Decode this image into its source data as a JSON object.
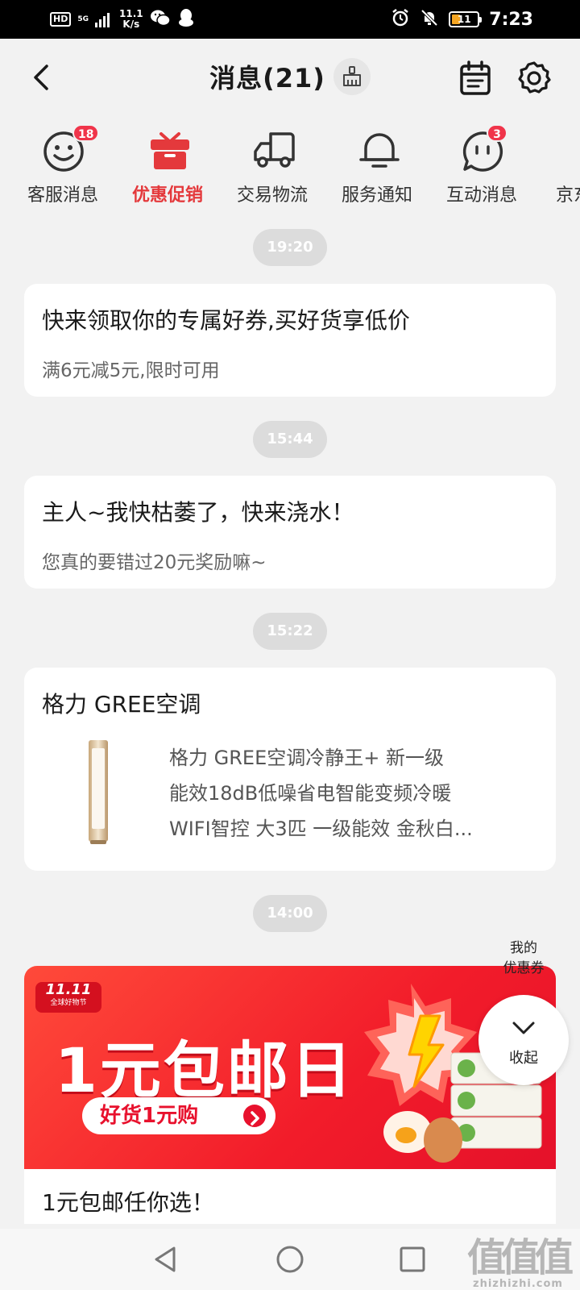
{
  "status_bar": {
    "hd": "HD",
    "network": "5G",
    "speed_value": "11.1",
    "speed_unit": "K/s",
    "battery": "11",
    "time": "7:23"
  },
  "header": {
    "title": "消息(21)"
  },
  "categories": [
    {
      "label": "客服消息",
      "badge": "18",
      "icon": "smiley-icon"
    },
    {
      "label": "优惠促销",
      "badge": "",
      "icon": "gift-icon",
      "active": true
    },
    {
      "label": "交易物流",
      "badge": "",
      "icon": "truck-icon"
    },
    {
      "label": "服务通知",
      "badge": "",
      "icon": "bell-icon"
    },
    {
      "label": "互动消息",
      "badge": "3",
      "icon": "chat-face-icon"
    },
    {
      "label": "京东",
      "badge": "",
      "icon": "more-icon"
    }
  ],
  "messages": [
    {
      "time": "19:20",
      "title": "快来领取你的专属好券,买好货享低价",
      "subtitle": "满6元减5元,限时可用"
    },
    {
      "time": "15:44",
      "title": "主人~我快枯萎了，快来浇水！",
      "subtitle": "您真的要错过20元奖励嘛~"
    },
    {
      "time": "15:22",
      "title": "格力   GREE空调",
      "product_lines": [
        "格力   GREE空调冷静王+ 新一级",
        "能效18dB低噪省电智能变频冷暖",
        "WIFI智控 大3匹 一级能效 金秋白..."
      ]
    },
    {
      "time": "14:00",
      "banner_logo_big": "11.11",
      "banner_logo_small": "全球好物节",
      "banner_title": "1元包邮日",
      "banner_button": "好货1元购",
      "title": "1元包邮任你选！"
    }
  ],
  "floating": {
    "coupon_line1": "我的",
    "coupon_line2": "优惠券",
    "collapse_label": "收起"
  },
  "watermark": {
    "big": "值值值",
    "small": "zhizhizhi.com"
  },
  "colors": {
    "accent": "#e4393c",
    "badge": "#f0344a",
    "background": "#f2f2f2"
  }
}
